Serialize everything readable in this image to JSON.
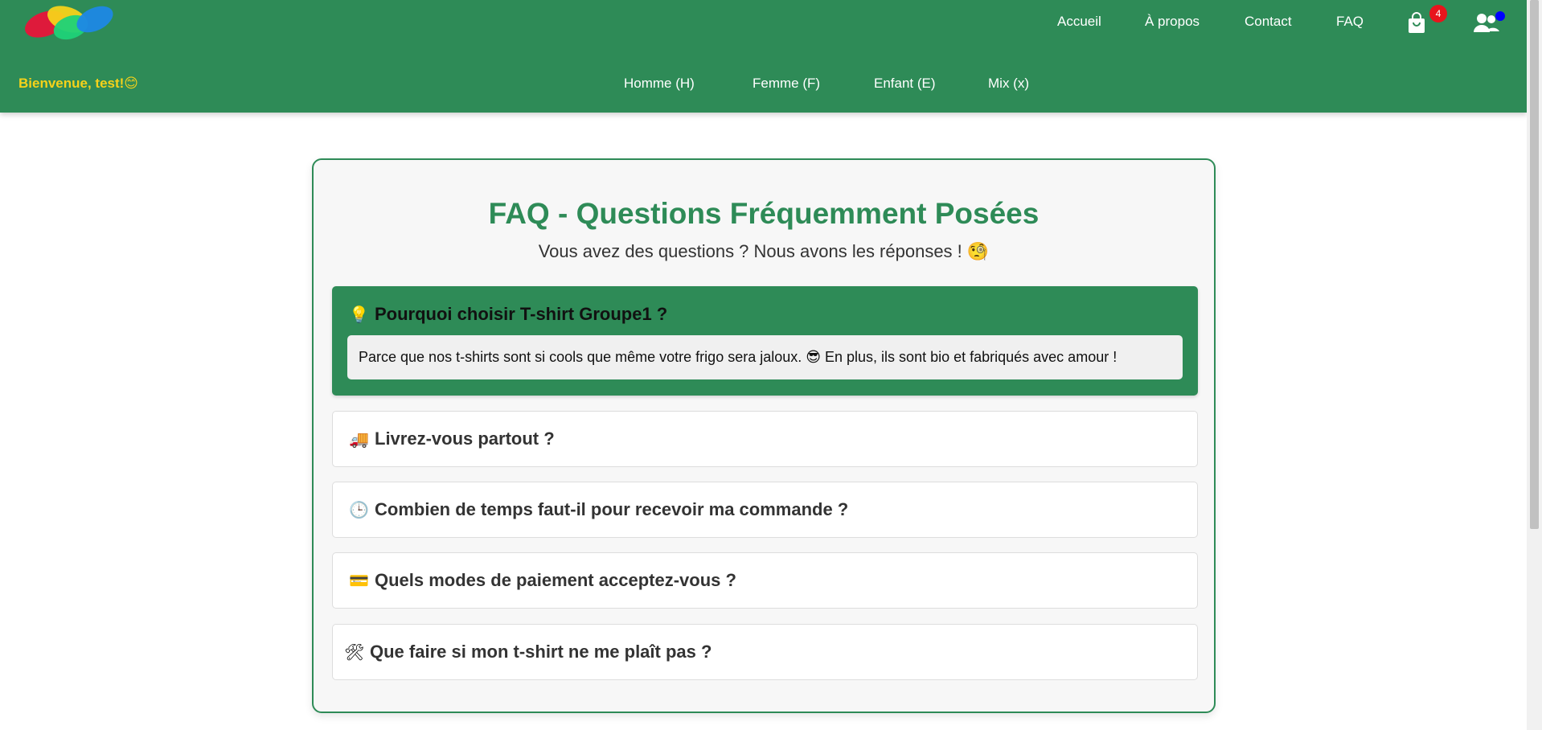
{
  "nav": {
    "top_links": [
      "Accueil",
      "À propos",
      "Contact",
      "FAQ"
    ],
    "cart_count": "4",
    "welcome": "Bienvenue, test!😊",
    "categories": [
      "Homme (H)",
      "Femme (F)",
      "Enfant (E)",
      "Mix (x)"
    ]
  },
  "faq": {
    "title": "FAQ - Questions Fréquemment Posées",
    "subtitle": "Vous avez des questions ? Nous avons les réponses ! 🧐",
    "items": [
      {
        "emoji": "💡",
        "question": "Pourquoi choisir T-shirt Groupe1 ?",
        "answer": "Parce que nos t-shirts sont si cools que même votre frigo sera jaloux. 😎 En plus, ils sont bio et fabriqués avec amour !",
        "expanded": true
      },
      {
        "emoji": "🚚",
        "question": "Livrez-vous partout ?",
        "expanded": false
      },
      {
        "emoji": "🕒",
        "question": "Combien de temps faut-il pour recevoir ma commande ?",
        "expanded": false
      },
      {
        "emoji": "💳",
        "question": "Quels modes de paiement acceptez-vous ?",
        "expanded": false
      },
      {
        "emoji": "🛠",
        "question": "Que faire si mon t-shirt ne me plaît pas ?",
        "expanded": false
      }
    ]
  },
  "colors": {
    "brand_green": "#2e8b57",
    "welcome_yellow": "#f5d21a",
    "badge_red": "#e8141c",
    "status_blue": "#0000ff"
  },
  "icons": [
    "logo",
    "cart-icon",
    "users-icon"
  ]
}
